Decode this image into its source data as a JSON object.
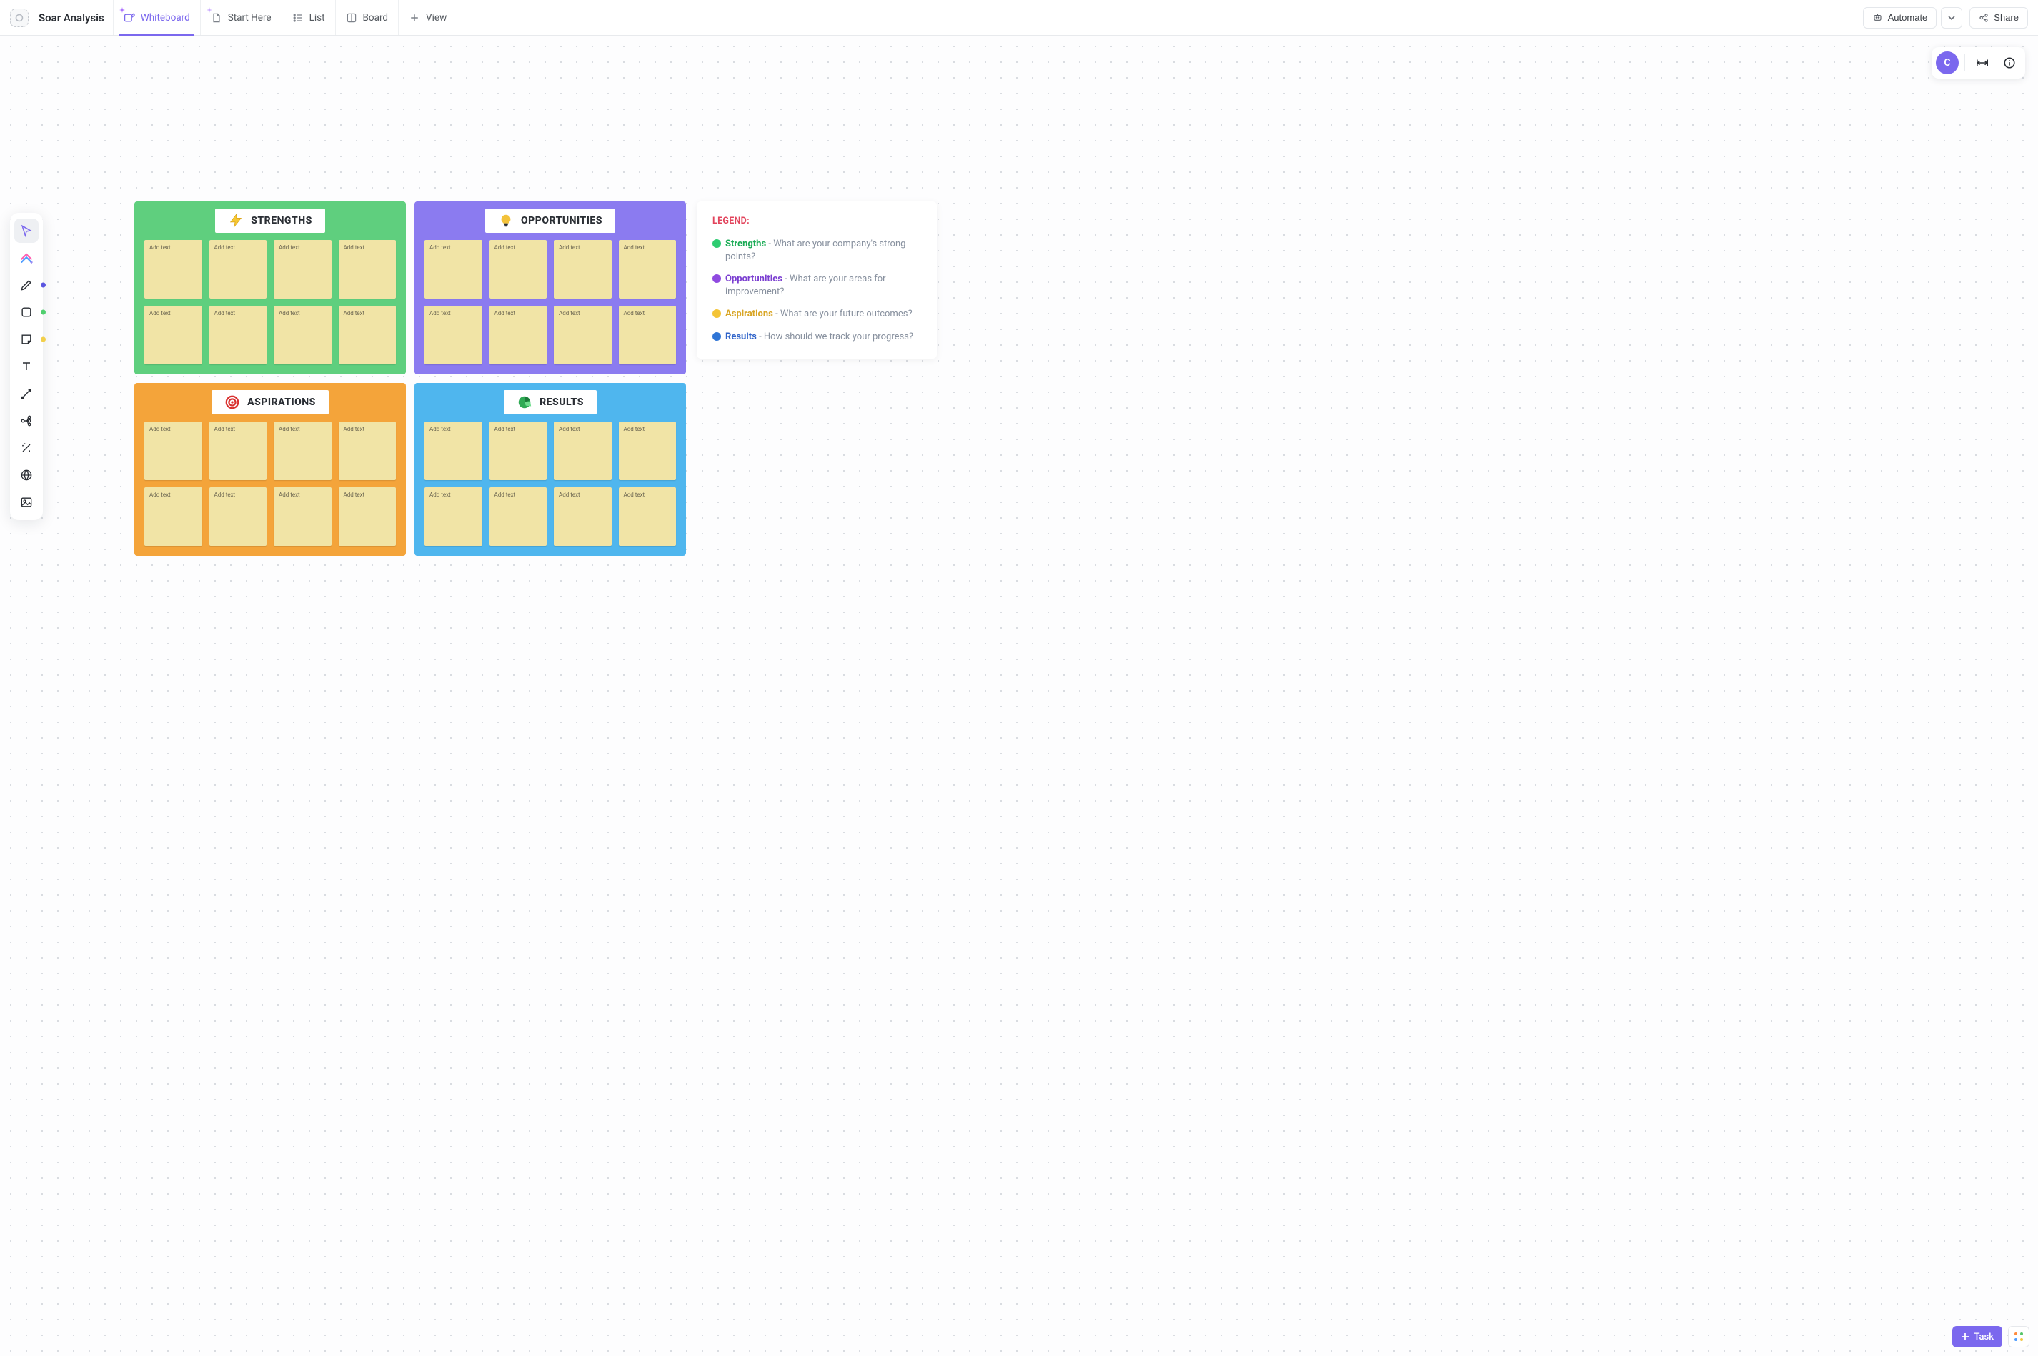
{
  "header": {
    "title": "Soar Analysis",
    "tabs": [
      {
        "label": "Whiteboard",
        "active": true
      },
      {
        "label": "Start Here"
      },
      {
        "label": "List"
      },
      {
        "label": "Board"
      }
    ],
    "add_view_label": "View",
    "automate_label": "Automate",
    "share_label": "Share"
  },
  "avatar_initial": "C",
  "toolbox": {
    "pen_dot_color": "#5a55e0",
    "shape_dot_color": "#4fcf6e",
    "sticky_dot_color": "#f2cf4a"
  },
  "quadrants": {
    "strengths": {
      "title": "STRENGTHS",
      "bg": "green"
    },
    "opportunities": {
      "title": "OPPORTUNITIES",
      "bg": "purple"
    },
    "aspirations": {
      "title": "ASPIRATIONS",
      "bg": "orange"
    },
    "results": {
      "title": "RESULTS",
      "bg": "blue"
    }
  },
  "note_placeholder": "Add text",
  "legend": {
    "title": "LEGEND:",
    "items": [
      {
        "dot": "#2ecc71",
        "key": "Strengths",
        "key_color": "#1aab55",
        "desc": "What are your company's strong points?"
      },
      {
        "dot": "#8f4ae0",
        "key": "Opportunities",
        "key_color": "#7b3fd1",
        "desc": "What are your areas for improvement?"
      },
      {
        "dot": "#f4c436",
        "key": "Aspirations",
        "key_color": "#d8a524",
        "desc": "What are your future outcomes?"
      },
      {
        "dot": "#2f75d6",
        "key": "Results",
        "key_color": "#2f63c9",
        "desc": "How should we track your progress?"
      }
    ]
  },
  "task_button_label": "Task"
}
